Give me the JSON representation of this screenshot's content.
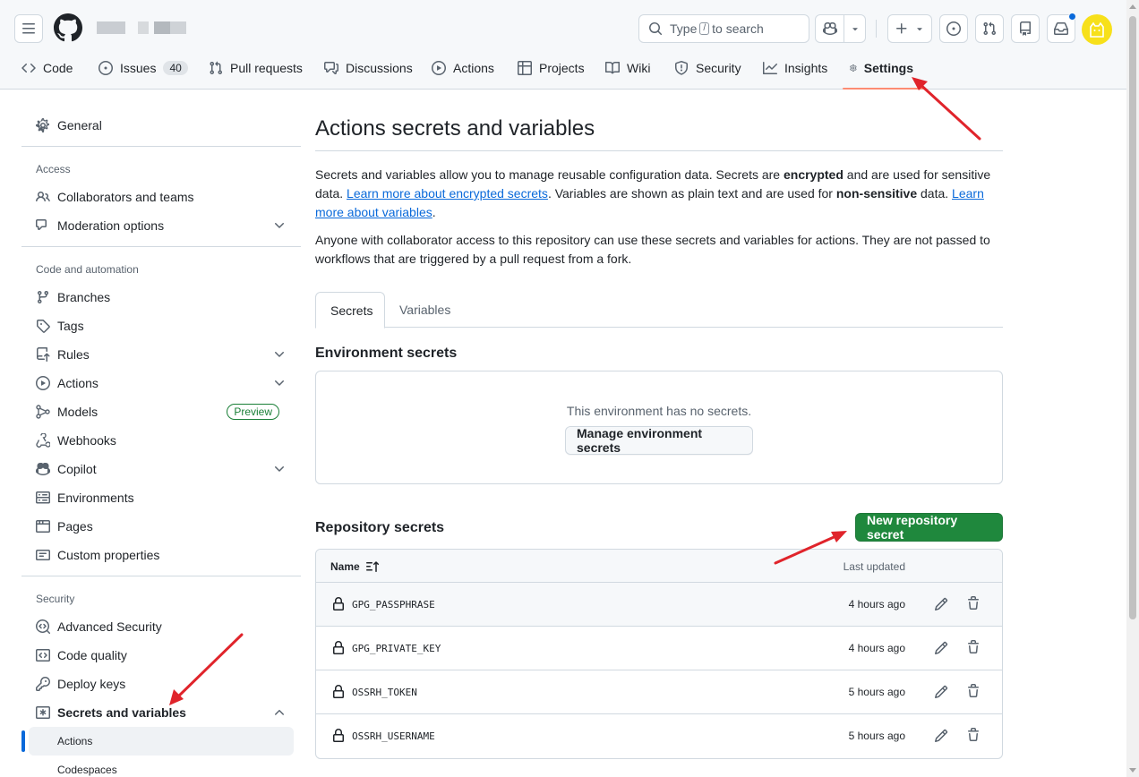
{
  "search": {
    "prefix": "Type",
    "key": "/",
    "suffix": "to search"
  },
  "tabs": [
    {
      "label": "Code",
      "icon": "code-icon"
    },
    {
      "label": "Issues",
      "icon": "issue-opened-icon",
      "count": "40"
    },
    {
      "label": "Pull requests",
      "icon": "git-pull-request-icon"
    },
    {
      "label": "Discussions",
      "icon": "comment-discussion-icon"
    },
    {
      "label": "Actions",
      "icon": "play-icon"
    },
    {
      "label": "Projects",
      "icon": "table-icon"
    },
    {
      "label": "Wiki",
      "icon": "book-icon"
    },
    {
      "label": "Security",
      "icon": "shield-icon"
    },
    {
      "label": "Insights",
      "icon": "graph-icon"
    },
    {
      "label": "Settings",
      "icon": "gear-icon",
      "selected": true
    }
  ],
  "sidebar": {
    "general": "General",
    "access_heading": "Access",
    "collaborators": "Collaborators and teams",
    "moderation": "Moderation options",
    "code_heading": "Code and automation",
    "branches": "Branches",
    "tags": "Tags",
    "rules": "Rules",
    "actions": "Actions",
    "models": "Models",
    "models_badge": "Preview",
    "webhooks": "Webhooks",
    "copilot": "Copilot",
    "environments": "Environments",
    "pages": "Pages",
    "custom_properties": "Custom properties",
    "security_heading": "Security",
    "advanced_security": "Advanced Security",
    "code_quality": "Code quality",
    "deploy_keys": "Deploy keys",
    "secrets_variables": "Secrets and variables",
    "sub_actions": "Actions",
    "sub_codespaces": "Codespaces"
  },
  "main": {
    "title": "Actions secrets and variables",
    "intro": {
      "p1": "Secrets and variables allow you to manage reusable configuration data. Secrets are ",
      "b1": "encrypted",
      "p2": " and are used for sensitive data. ",
      "link1": "Learn more about encrypted secrets",
      "p3": ". Variables are shown as plain text and are used for ",
      "b2": "non-sensitive",
      "p4": " data. ",
      "link2": "Learn more about variables",
      "p5": "."
    },
    "notice": "Anyone with collaborator access to this repository can use these secrets and variables for actions. They are not passed to workflows that are triggered by a pull request from a fork.",
    "subtabs": {
      "secrets": "Secrets",
      "variables": "Variables"
    },
    "env_title": "Environment secrets",
    "env_empty": "This environment has no secrets.",
    "env_button": "Manage environment secrets",
    "repo_title": "Repository secrets",
    "new_secret_button": "New repository secret",
    "table": {
      "col_name": "Name",
      "col_updated": "Last updated",
      "rows": [
        {
          "name": "GPG_PASSPHRASE",
          "updated": "4 hours ago"
        },
        {
          "name": "GPG_PRIVATE_KEY",
          "updated": "4 hours ago"
        },
        {
          "name": "OSSRH_TOKEN",
          "updated": "5 hours ago"
        },
        {
          "name": "OSSRH_USERNAME",
          "updated": "5 hours ago"
        }
      ]
    }
  },
  "colors": {
    "accent": "#0969da",
    "primary_button": "#1f883d",
    "tab_underline": "#fd8c73",
    "annotation_arrow": "#e0242b",
    "avatar": "#f7e01a"
  }
}
